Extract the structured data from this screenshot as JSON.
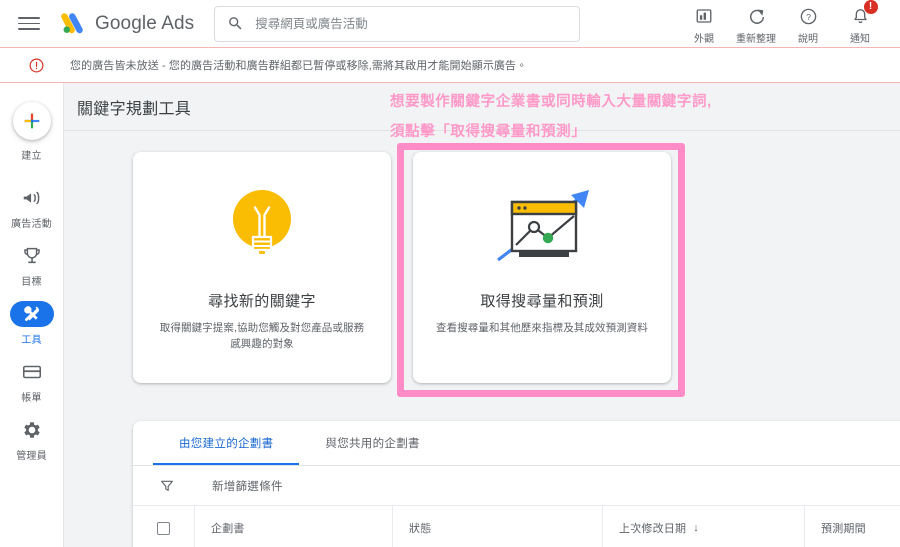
{
  "topbar": {
    "menu_icon": "hamburger-icon",
    "brand": "Google Ads",
    "brand_google": "Google",
    "brand_ads": "Ads",
    "search": {
      "placeholder": "搜尋網頁或廣告活動",
      "value": "",
      "icon": "search-icon"
    },
    "actions": [
      {
        "label": "外觀",
        "icon": "bar-chart-icon",
        "badge": ""
      },
      {
        "label": "重新整理",
        "icon": "refresh-icon",
        "badge": ""
      },
      {
        "label": "說明",
        "icon": "help-circle-icon",
        "badge": ""
      },
      {
        "label": "通知",
        "icon": "bell-icon",
        "badge": "!"
      }
    ]
  },
  "alert": {
    "icon": "error-circle-icon",
    "text": "您的廣告皆未放送 - 您的廣告活動和廣告群組都已暫停或移除,需將其啟用才能開始顯示廣告。",
    "border_color": "#f3b6b4",
    "icon_color": "#d93025"
  },
  "sidebar": {
    "items": [
      {
        "label": "建立",
        "icon": "plus-icon",
        "active": false
      },
      {
        "label": "廣告活動",
        "icon": "megaphone-icon",
        "active": false
      },
      {
        "label": "目標",
        "icon": "trophy-icon",
        "active": false
      },
      {
        "label": "工具",
        "icon": "tools-wrench-icon",
        "active": true
      },
      {
        "label": "帳單",
        "icon": "credit-card-icon",
        "active": false
      },
      {
        "label": "管理員",
        "icon": "gear-icon",
        "active": false
      }
    ],
    "active_color": "#1a73e8"
  },
  "page": {
    "title": "關鍵字規劃工具",
    "background": "#f1f3f4"
  },
  "annotation": {
    "line1": "想要製作關鍵字企業書或同時輸入大量關鍵字詞,",
    "line2": "須點擊「取得搜尋量和預測」",
    "color": "#ff9ac9",
    "highlight_color": "#ff8cc6"
  },
  "cards": [
    {
      "title": "尋找新的關鍵字",
      "description": "取得關鍵字提案,協助您觸及對您產品或服務感興趣的對象",
      "icon": "lightbulb-icon",
      "icon_color": "#fbbc04",
      "highlighted": false
    },
    {
      "title": "取得搜尋量和預測",
      "description": "查看搜尋量和其他歷來指標及其成效預測資料",
      "icon": "forecast-chart-window-icon",
      "icon_color": "#fbbc04",
      "highlighted": true
    }
  ],
  "panel": {
    "tabs": [
      {
        "label": "由您建立的企劃書",
        "active": true
      },
      {
        "label": "與您共用的企劃書",
        "active": false
      }
    ],
    "filter": {
      "icon": "filter-funnel-icon",
      "label": "新增篩選條件"
    },
    "table": {
      "columns": [
        {
          "key": "check",
          "label": "",
          "icon": "checkbox-icon"
        },
        {
          "key": "plan",
          "label": "企劃書",
          "sort": ""
        },
        {
          "key": "status",
          "label": "狀態",
          "sort": ""
        },
        {
          "key": "date",
          "label": "上次修改日期",
          "sort": "↓"
        },
        {
          "key": "period",
          "label": "預測期間",
          "sort": ""
        }
      ],
      "rows": []
    }
  }
}
